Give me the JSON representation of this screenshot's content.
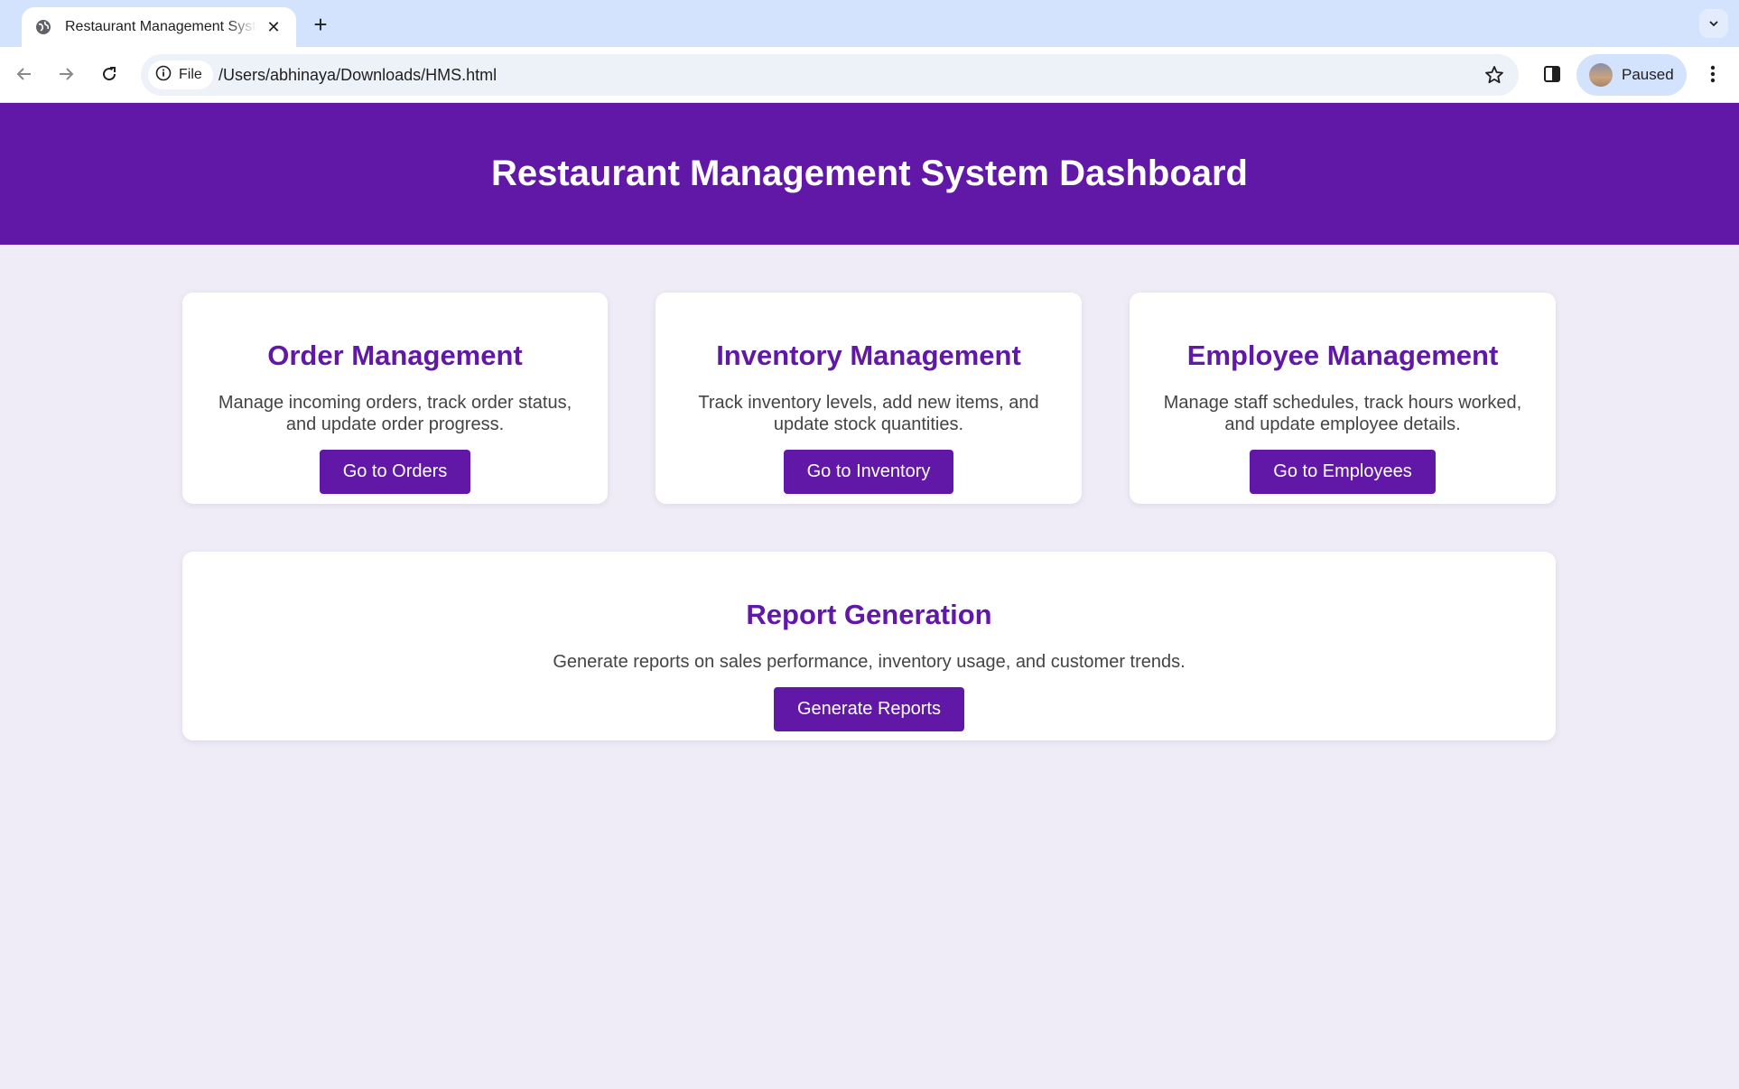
{
  "browser": {
    "tab_title": "Restaurant Management System Dashboard",
    "site_chip": "File",
    "url": "/Users/abhinaya/Downloads/HMS.html",
    "profile_label": "Paused",
    "icons": [
      "globe-icon",
      "close-icon",
      "plus-icon",
      "chevron-down-icon",
      "back-arrow-icon",
      "forward-arrow-icon",
      "reload-icon",
      "info-icon",
      "star-icon",
      "side-panel-icon",
      "kebab-menu-icon"
    ]
  },
  "header": {
    "title": "Restaurant Management System Dashboard"
  },
  "cards": [
    {
      "title": "Order Management",
      "description": "Manage incoming orders, track order status, and update order progress.",
      "button": "Go to Orders"
    },
    {
      "title": "Inventory Management",
      "description": "Track inventory levels, add new items, and update stock quantities.",
      "button": "Go to Inventory"
    },
    {
      "title": "Employee Management",
      "description": "Manage staff schedules, track hours worked, and update employee details.",
      "button": "Go to Employees"
    },
    {
      "title": "Report Generation",
      "description": "Generate reports on sales performance, inventory usage, and customer trends.",
      "button": "Generate Reports"
    }
  ],
  "colors": {
    "accent": "#6218a6",
    "page_background": "#efecf7",
    "tab_strip": "#d3e3fd"
  }
}
